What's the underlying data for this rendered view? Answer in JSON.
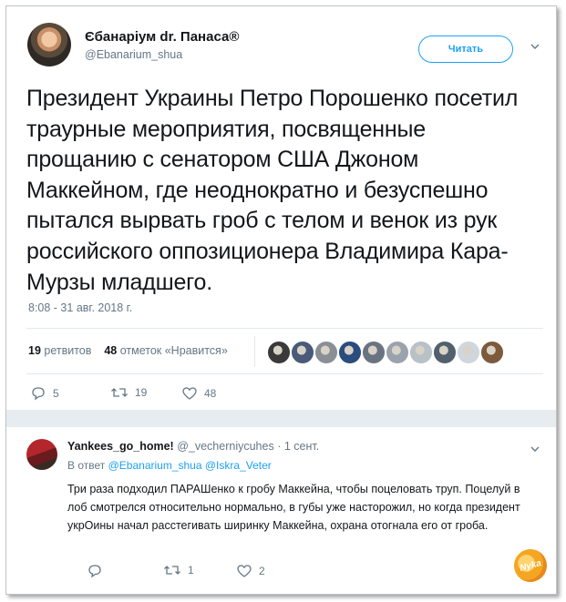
{
  "tweet": {
    "author_name": "Єбанаріум dr. Панаса®",
    "author_handle": "@Ebanarium_shua",
    "follow_label": "Читать",
    "text": "Президент Украины Петро Порошенко посетил траурные мероприятия, посвященные прощанию с сенатором США Джоном Маккейном, где неоднократно и безуспешно пытался вырвать гроб с телом и венок из рук российского оппозиционера Владимира Кара-Мурзы младшего.",
    "timestamp": "8:08 - 31 авг. 2018 г.",
    "retweets_count": "19",
    "retweets_label": "ретвитов",
    "likes_count": "48",
    "likes_label": "отметок «Нравится»",
    "reply_count": "5",
    "retweet_action_count": "19",
    "like_action_count": "48"
  },
  "likers": [
    "#3a3a3a",
    "#4a5a78",
    "#8a8f96",
    "#2b4c7e",
    "#6a7480",
    "#9aa3ad",
    "#b8c0c8",
    "#52606d",
    "#cfd6dc",
    "#7d5a3c"
  ],
  "reply": {
    "author_name": "Yankees_go_home!",
    "author_handle": "@_vecherniycuhes",
    "time": "· 1 сент.",
    "in_reply_prefix": "В ответ",
    "in_reply_user1": "@Ebanarium_shua",
    "in_reply_user2": "@Iskra_Veter",
    "text": "Три раза подходил ПАРАШенко к гробу Маккейна, чтобы поцеловать труп. Поцелуй в лоб смотрелся относительно нормально, в губы уже насторожил, но когда президент укрОины начал расстегивать ширинку Маккейна, охрана отогнала его от гроба.",
    "retweet_count": "1",
    "like_count": "2"
  },
  "watermark_text": "Nyka",
  "colors": {
    "accent": "#1da1f2",
    "secondary_text": "#657786",
    "divider": "#e1e8ed"
  }
}
